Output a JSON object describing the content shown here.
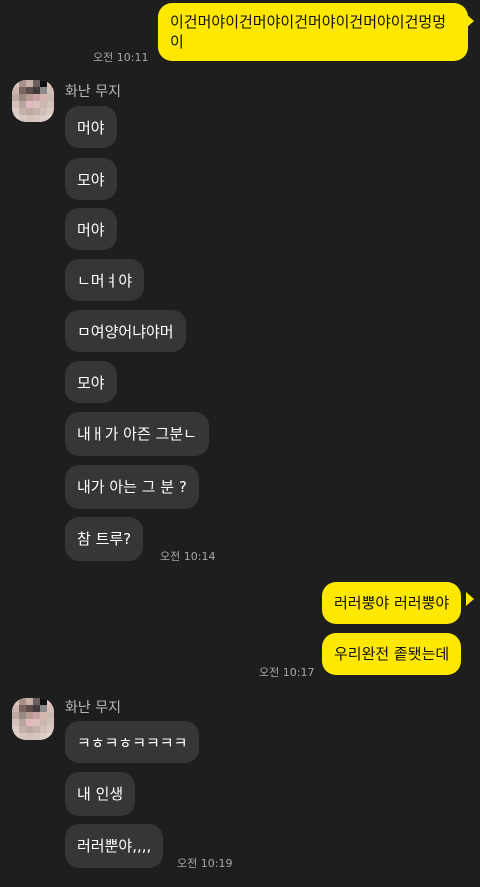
{
  "colors": {
    "background": "#1e1e1e",
    "incoming_bubble": "#363636",
    "outgoing_bubble": "#ffe800",
    "timestamp": "#a8a8a8"
  },
  "messages": {
    "out1": {
      "text": "이건머야이건머야이건머야이건머야이건멍멍이",
      "time": "오전 10:11"
    },
    "group1": {
      "sender": "화난 무지",
      "items": [
        "머야",
        "모야",
        "머야",
        "ㄴ머ㅕ야",
        "ㅁ여양어냐야머",
        "모야",
        "내ㅐ가 아즌 그분ㄴ",
        "내가 아는 그 분 ?",
        "참 트루?"
      ],
      "time": "오전 10:14"
    },
    "out2": {
      "items": [
        "러러뿡야 러러뿡야",
        "우리완전 좉됏는데"
      ],
      "time": "오전 10:17"
    },
    "group2": {
      "sender": "화난 무지",
      "items": [
        "ㅋㅎㅋㅎㅋㅋㅋㅋ",
        "내 인생",
        "러러뿐야,,,,"
      ],
      "time": "오전 10:19"
    }
  },
  "avatar_icon": "blurred-profile-avatar"
}
